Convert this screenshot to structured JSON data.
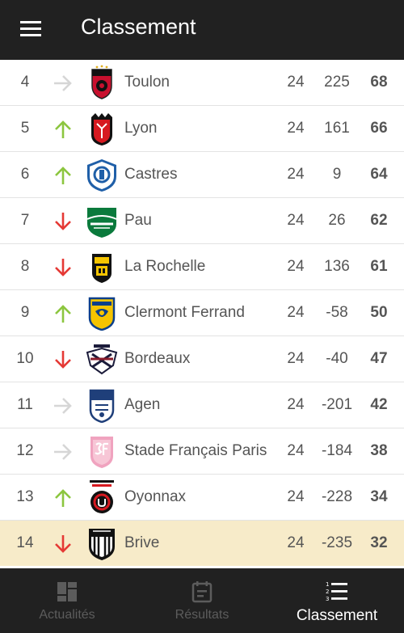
{
  "header": {
    "title": "Classement"
  },
  "colors": {
    "up": "#8cc63f",
    "down": "#e53935",
    "same": "#d6d6d6",
    "highlight": "#f7ebc9"
  },
  "standings": [
    {
      "rank": "4",
      "trend": "same",
      "team": "Toulon",
      "played": "24",
      "diff": "225",
      "points": "68",
      "logo": "toulon-logo"
    },
    {
      "rank": "5",
      "trend": "up",
      "team": "Lyon",
      "played": "24",
      "diff": "161",
      "points": "66",
      "logo": "lyon-logo"
    },
    {
      "rank": "6",
      "trend": "up",
      "team": "Castres",
      "played": "24",
      "diff": "9",
      "points": "64",
      "logo": "castres-logo"
    },
    {
      "rank": "7",
      "trend": "down",
      "team": "Pau",
      "played": "24",
      "diff": "26",
      "points": "62",
      "logo": "pau-logo"
    },
    {
      "rank": "8",
      "trend": "down",
      "team": "La Rochelle",
      "played": "24",
      "diff": "136",
      "points": "61",
      "logo": "la-rochelle-logo"
    },
    {
      "rank": "9",
      "trend": "up",
      "team": "Clermont Ferrand",
      "played": "24",
      "diff": "-58",
      "points": "50",
      "logo": "clermont-logo"
    },
    {
      "rank": "10",
      "trend": "down",
      "team": "Bordeaux",
      "played": "24",
      "diff": "-40",
      "points": "47",
      "logo": "bordeaux-logo"
    },
    {
      "rank": "11",
      "trend": "same",
      "team": "Agen",
      "played": "24",
      "diff": "-201",
      "points": "42",
      "logo": "agen-logo"
    },
    {
      "rank": "12",
      "trend": "same",
      "team": "Stade Français Paris",
      "played": "24",
      "diff": "-184",
      "points": "38",
      "logo": "stade-francais-logo"
    },
    {
      "rank": "13",
      "trend": "up",
      "team": "Oyonnax",
      "played": "24",
      "diff": "-228",
      "points": "34",
      "logo": "oyonnax-logo"
    },
    {
      "rank": "14",
      "trend": "down",
      "team": "Brive",
      "played": "24",
      "diff": "-235",
      "points": "32",
      "logo": "brive-logo"
    }
  ],
  "nav": {
    "actualites": {
      "label": "Actualités",
      "icon": "dashboard-icon"
    },
    "resultats": {
      "label": "Résultats",
      "icon": "calendar-icon"
    },
    "classement": {
      "label": "Classement",
      "icon": "ranked-list-icon",
      "active": true
    }
  }
}
